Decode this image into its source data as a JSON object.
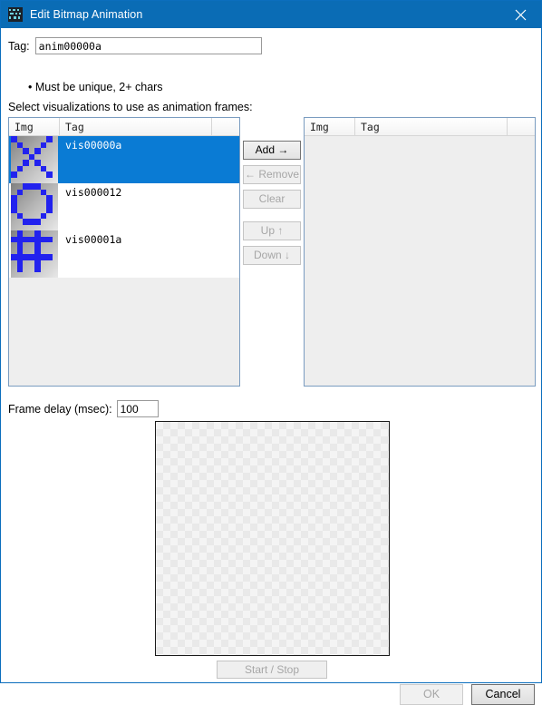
{
  "window": {
    "title": "Edit Bitmap Animation",
    "icon": "bitmap-animation-icon",
    "close_icon": "close-icon"
  },
  "tag_field": {
    "label": "Tag:",
    "value": "anim00000a",
    "placeholder": "",
    "hint": "• Must be unique, 2+ chars"
  },
  "section": {
    "label": "Select visualizations to use as animation frames:"
  },
  "available_list": {
    "columns": [
      "Img",
      "Tag"
    ],
    "rows": [
      {
        "tag": "vis00000a",
        "selected": true,
        "pattern": "x-cross"
      },
      {
        "tag": "vis000012",
        "selected": false,
        "pattern": "ring"
      },
      {
        "tag": "vis00001a",
        "selected": false,
        "pattern": "hash"
      }
    ]
  },
  "frames_list": {
    "columns": [
      "Img",
      "Tag"
    ],
    "rows": []
  },
  "transfer_buttons": [
    {
      "label": "Add →",
      "enabled": true,
      "name": "add-button"
    },
    {
      "label": "← Remove",
      "enabled": false,
      "name": "remove-button"
    },
    {
      "label": "Clear",
      "enabled": false,
      "name": "clear-button"
    },
    {
      "label": "Up ↑",
      "enabled": false,
      "name": "move-up-button"
    },
    {
      "label": "Down ↓",
      "enabled": false,
      "name": "move-down-button"
    }
  ],
  "frame_delay": {
    "label": "Frame delay (msec):",
    "value": "100"
  },
  "preview": {
    "start_stop_label": "Start / Stop",
    "start_stop_enabled": false
  },
  "footer": {
    "ok_label": "OK",
    "ok_enabled": false,
    "cancel_label": "Cancel",
    "cancel_enabled": true
  },
  "colors": {
    "titlebar": "#0a6cb5",
    "selection": "#0a7bd4",
    "bitmap_pixel": "#2222ee",
    "list_border": "#7a9cc0",
    "disabled_text": "#a6a6a6"
  },
  "bitmap_patterns": {
    "x-cross": [
      [
        1,
        0,
        0,
        0,
        0,
        0,
        1,
        0
      ],
      [
        0,
        1,
        0,
        0,
        0,
        1,
        0,
        0
      ],
      [
        0,
        0,
        1,
        0,
        1,
        0,
        0,
        0
      ],
      [
        0,
        0,
        0,
        1,
        0,
        0,
        0,
        0
      ],
      [
        0,
        0,
        1,
        0,
        1,
        0,
        0,
        0
      ],
      [
        0,
        1,
        0,
        0,
        0,
        1,
        0,
        0
      ],
      [
        1,
        0,
        0,
        0,
        0,
        0,
        1,
        0
      ],
      [
        0,
        0,
        0,
        0,
        0,
        0,
        0,
        0
      ]
    ],
    "ring": [
      [
        0,
        0,
        1,
        1,
        1,
        0,
        0,
        0
      ],
      [
        0,
        1,
        0,
        0,
        0,
        1,
        0,
        0
      ],
      [
        1,
        0,
        0,
        0,
        0,
        0,
        1,
        0
      ],
      [
        1,
        0,
        0,
        0,
        0,
        0,
        1,
        0
      ],
      [
        1,
        0,
        0,
        0,
        0,
        0,
        1,
        0
      ],
      [
        0,
        1,
        0,
        0,
        0,
        1,
        0,
        0
      ],
      [
        0,
        0,
        1,
        1,
        1,
        0,
        0,
        0
      ],
      [
        0,
        0,
        0,
        0,
        0,
        0,
        0,
        0
      ]
    ],
    "hash": [
      [
        0,
        1,
        0,
        0,
        1,
        0,
        0,
        0
      ],
      [
        1,
        1,
        1,
        1,
        1,
        1,
        1,
        0
      ],
      [
        0,
        1,
        0,
        0,
        1,
        0,
        0,
        0
      ],
      [
        0,
        1,
        0,
        0,
        1,
        0,
        0,
        0
      ],
      [
        1,
        1,
        1,
        1,
        1,
        1,
        1,
        0
      ],
      [
        0,
        1,
        0,
        0,
        1,
        0,
        0,
        0
      ],
      [
        0,
        1,
        0,
        0,
        1,
        0,
        0,
        0
      ],
      [
        0,
        0,
        0,
        0,
        0,
        0,
        0,
        0
      ]
    ]
  }
}
